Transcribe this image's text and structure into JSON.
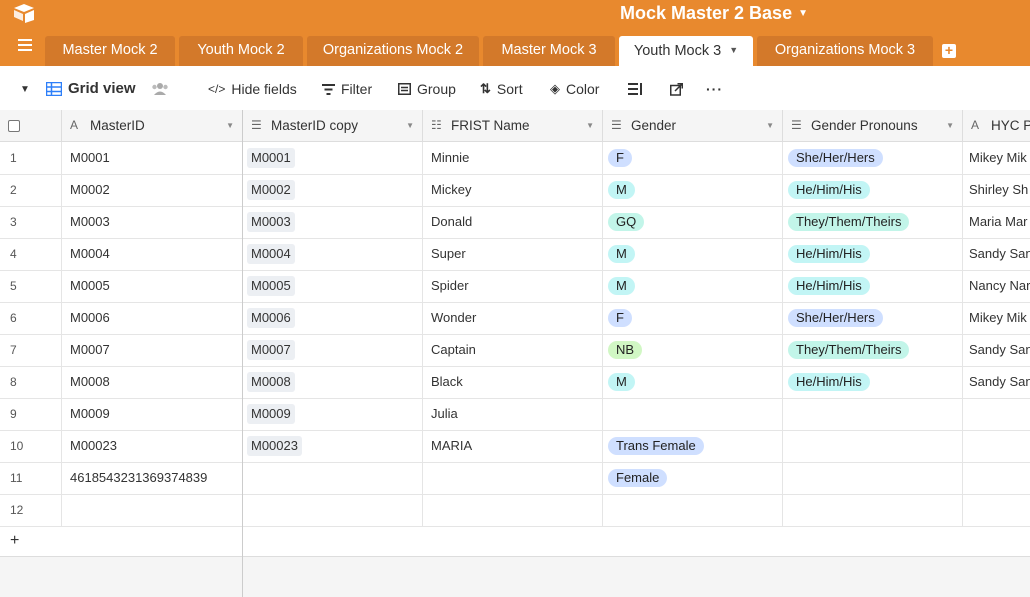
{
  "app": {
    "base_title": "Mock Master 2 Base"
  },
  "tabs": [
    {
      "label": "Master Mock 2",
      "active": false
    },
    {
      "label": "Youth Mock 2",
      "active": false
    },
    {
      "label": "Organizations Mock 2",
      "active": false
    },
    {
      "label": "Master Mock 3",
      "active": false
    },
    {
      "label": "Youth Mock 3",
      "active": true
    },
    {
      "label": "Organizations Mock 3",
      "active": false
    }
  ],
  "toolbar": {
    "view_name": "Grid view",
    "hide_fields": "Hide fields",
    "filter": "Filter",
    "group": "Group",
    "sort": "Sort",
    "color": "Color"
  },
  "columns": [
    "MasterID",
    "MasterID copy",
    "FRIST Name",
    "Gender",
    "Gender Pronouns",
    "HYC Po"
  ],
  "colors": {
    "accent": "#e8892e",
    "pill_blue": "#cfdfff",
    "pill_cyan": "#c2f5f5",
    "pill_teal": "#c2f5e9",
    "pill_green": "#d1f7c4"
  },
  "rows": [
    {
      "num": "1",
      "masterid": "M0001",
      "copy": "M0001",
      "first": "Minnie",
      "gender": "F",
      "gender_color": "#cfdfff",
      "pronouns": "She/Her/Hers",
      "pronoun_color": "#cfdfff",
      "hyc": "Mikey Mik"
    },
    {
      "num": "2",
      "masterid": "M0002",
      "copy": "M0002",
      "first": "Mickey",
      "gender": "M",
      "gender_color": "#c2f5f5",
      "pronouns": "He/Him/His",
      "pronoun_color": "#c2f5f5",
      "hyc": "Shirley Sh"
    },
    {
      "num": "3",
      "masterid": "M0003",
      "copy": "M0003",
      "first": "Donald",
      "gender": "GQ",
      "gender_color": "#c2f5e9",
      "pronouns": "They/Them/Theirs",
      "pronoun_color": "#c2f5e9",
      "hyc": "Maria Mar"
    },
    {
      "num": "4",
      "masterid": "M0004",
      "copy": "M0004",
      "first": "Super",
      "gender": "M",
      "gender_color": "#c2f5f5",
      "pronouns": "He/Him/His",
      "pronoun_color": "#c2f5f5",
      "hyc": "Sandy San"
    },
    {
      "num": "5",
      "masterid": "M0005",
      "copy": "M0005",
      "first": "Spider",
      "gender": "M",
      "gender_color": "#c2f5f5",
      "pronouns": "He/Him/His",
      "pronoun_color": "#c2f5f5",
      "hyc": "Nancy Nar"
    },
    {
      "num": "6",
      "masterid": "M0006",
      "copy": "M0006",
      "first": "Wonder",
      "gender": "F",
      "gender_color": "#cfdfff",
      "pronouns": "She/Her/Hers",
      "pronoun_color": "#cfdfff",
      "hyc": "Mikey Mik"
    },
    {
      "num": "7",
      "masterid": "M0007",
      "copy": "M0007",
      "first": "Captain",
      "gender": "NB",
      "gender_color": "#d1f7c4",
      "pronouns": "They/Them/Theirs",
      "pronoun_color": "#c2f5e9",
      "hyc": "Sandy San"
    },
    {
      "num": "8",
      "masterid": "M0008",
      "copy": "M0008",
      "first": "Black",
      "gender": "M",
      "gender_color": "#c2f5f5",
      "pronouns": "He/Him/His",
      "pronoun_color": "#c2f5f5",
      "hyc": "Sandy San"
    },
    {
      "num": "9",
      "masterid": "M0009",
      "copy": "M0009",
      "first": "Julia",
      "gender": "",
      "gender_color": "",
      "pronouns": "",
      "pronoun_color": "",
      "hyc": ""
    },
    {
      "num": "10",
      "masterid": "M00023",
      "copy": "M00023",
      "first": "MARIA",
      "gender": "Trans Female",
      "gender_color": "#cfdfff",
      "pronouns": "",
      "pronoun_color": "",
      "hyc": ""
    },
    {
      "num": "11",
      "masterid": "4618543231369374839",
      "copy": "",
      "first": "",
      "gender": "Female",
      "gender_color": "#cfdfff",
      "pronouns": "",
      "pronoun_color": "",
      "hyc": ""
    },
    {
      "num": "12",
      "masterid": "",
      "copy": "",
      "first": "",
      "gender": "",
      "gender_color": "",
      "pronouns": "",
      "pronoun_color": "",
      "hyc": ""
    }
  ],
  "footer": {
    "add_symbol": "+"
  }
}
